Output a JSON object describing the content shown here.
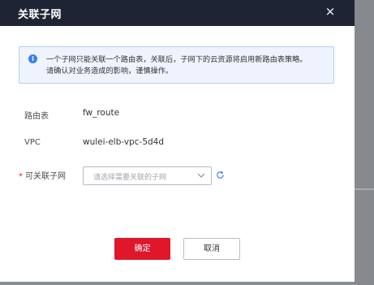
{
  "dialog": {
    "title": "关联子网",
    "close_icon": "×"
  },
  "notice": {
    "icon": "i",
    "line1": "一个子网只能关联一个路由表，关联后，子网下的云资源将启用新路由表策略。",
    "line2": "请确认对业务造成的影响，谨慎操作。"
  },
  "fields": {
    "route_table_label": "路由表",
    "route_table_value": "fw_route",
    "vpc_label": "VPC",
    "vpc_value": "wulei-elb-vpc-5d4d",
    "subnet_required_mark": "*",
    "subnet_label": "可关联子网",
    "subnet_placeholder": "请选择需要关联的子网"
  },
  "buttons": {
    "confirm": "确定",
    "cancel": "取消"
  },
  "colors": {
    "header_bg": "#1e2433",
    "primary": "#e0162b",
    "info": "#3b7ef2"
  }
}
